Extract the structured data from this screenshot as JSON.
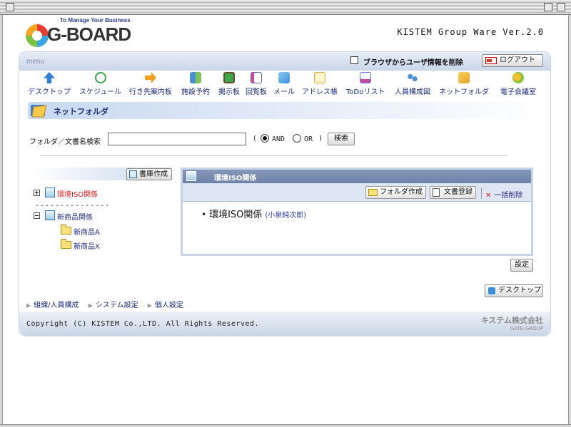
{
  "header": {
    "logo_tagline": "To Manage Your Business",
    "logo_text": "G-BOARD",
    "version": "KISTEM Group Ware Ver.2.0"
  },
  "menu": {
    "label": "menu",
    "delete_user_info_label": "ブラウザからユーザ情報を削除",
    "logout_label": "ログアウト"
  },
  "nav": {
    "items": [
      {
        "label": "デスクトップ",
        "icon": "desktop-arrow-icon",
        "color": "#2f7fd6"
      },
      {
        "label": "スケジュール",
        "icon": "clock-icon",
        "color": "#3aa84a"
      },
      {
        "label": "行き先案内板",
        "icon": "arrow-right-icon",
        "color": "#f0a020"
      },
      {
        "label": "施設予約",
        "icon": "facility-icon",
        "color": "#4a8fd0"
      },
      {
        "label": "掲示板",
        "icon": "board-icon",
        "color": "#3aa84a"
      },
      {
        "label": "回覧板",
        "icon": "checklist-icon",
        "color": "#c84a9a"
      },
      {
        "label": "メール",
        "icon": "mail-icon",
        "color": "#3a8fe0"
      },
      {
        "label": "アドレス帳",
        "icon": "address-book-icon",
        "color": "#e8a02a"
      },
      {
        "label": "ToDoリスト",
        "icon": "todo-icon",
        "color": "#5a7ad8"
      },
      {
        "label": "人員構成図",
        "icon": "org-chart-icon",
        "color": "#4a8fd0"
      },
      {
        "label": "ネットフォルダ",
        "icon": "net-folder-icon",
        "color": "#e8a02a"
      },
      {
        "label": "電子会議室",
        "icon": "meeting-room-icon",
        "color": "#8ac43a"
      }
    ]
  },
  "page": {
    "title": "ネットフォルダ"
  },
  "search": {
    "label": "フォルダ／文書名検索",
    "value": "",
    "paren_open": "(",
    "and_label": "AND",
    "or_label": "OR",
    "paren_close": ")",
    "button_label": "検索"
  },
  "tree": {
    "create_label": "書庫作成",
    "separator": "---------------",
    "cabinets": [
      {
        "label": "環境ISO関係",
        "color": "#e01818"
      },
      {
        "label": "新商品関係",
        "color": "#1a2a7a"
      }
    ],
    "folders": [
      "新商品A",
      "新商品X"
    ]
  },
  "panel": {
    "title": "環境ISO関係",
    "create_folder_label": "フォルダ作成",
    "register_doc_label": "文書登録",
    "bulk_delete_label": "一括削除",
    "entry_name": "環境ISO関係",
    "entry_author": "(小泉純次郎)"
  },
  "buttons": {
    "settings_label": "設定",
    "desktop_label": "デスクトップ"
  },
  "links": [
    "組織/人員構成",
    "システム設定",
    "個人設定"
  ],
  "footer": {
    "copyright": "Copyright (C) KISTEM Co.,LTD. All Rights Reserved.",
    "company": "キステム株式会社",
    "group": "GATE-GROUP"
  }
}
